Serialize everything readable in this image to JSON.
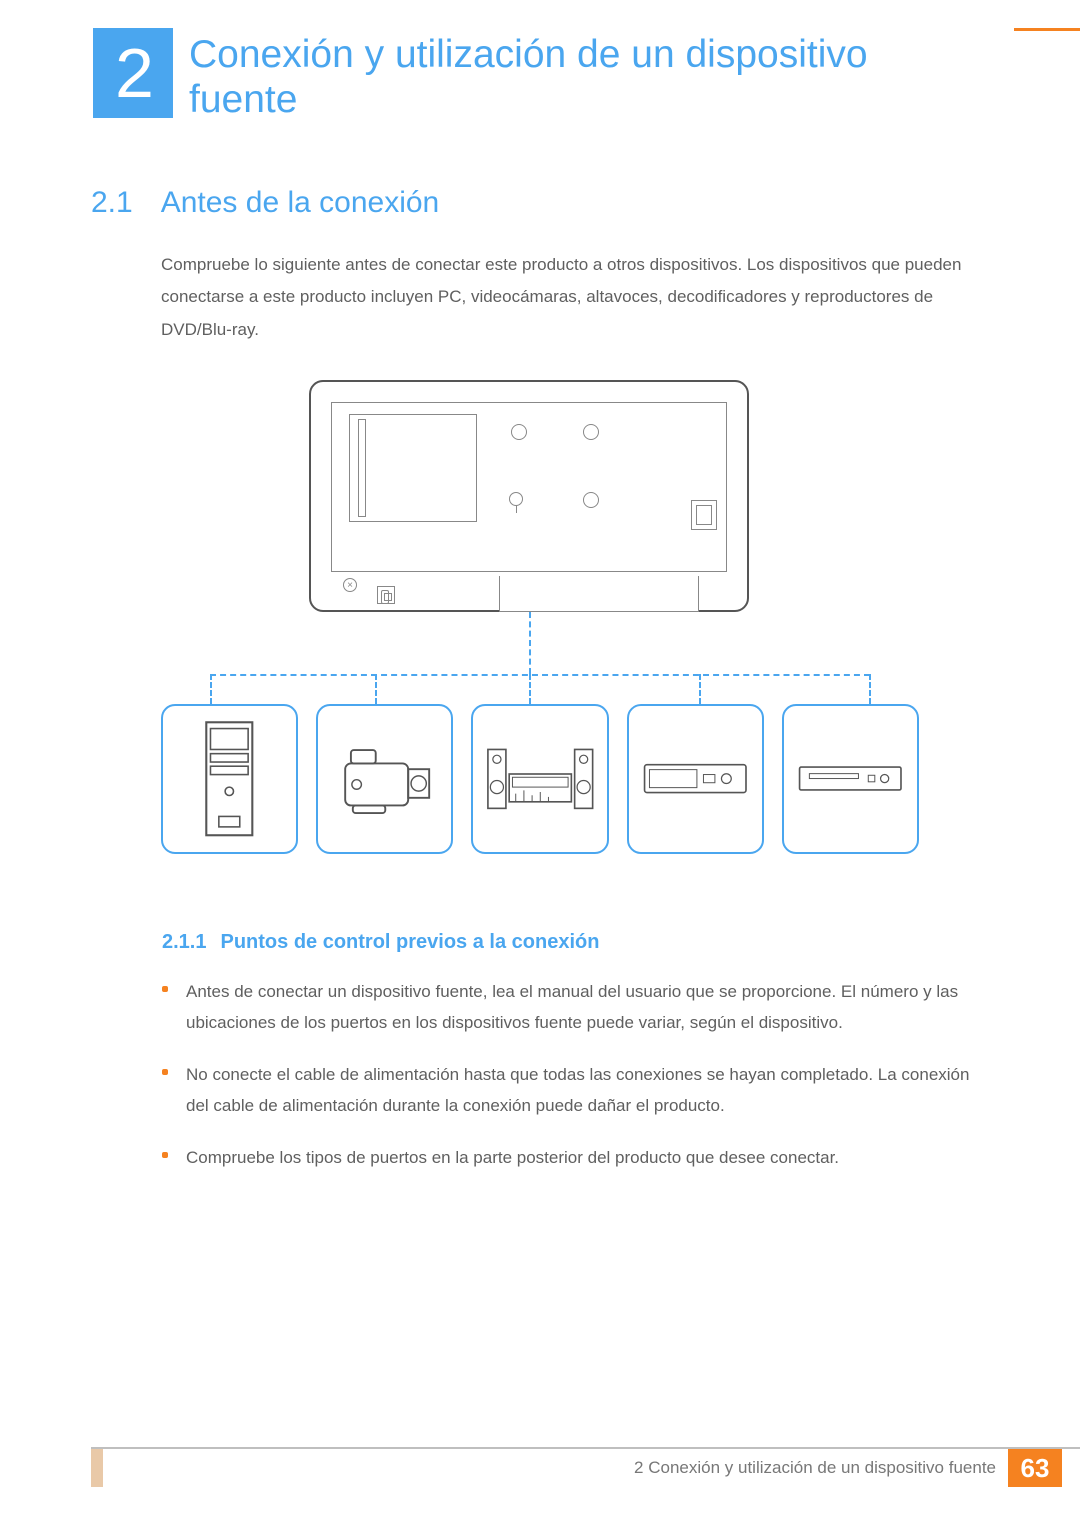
{
  "chapter": {
    "number": "2",
    "title": "Conexión y utilización de un dispositivo fuente"
  },
  "section": {
    "number": "2.1",
    "title": "Antes de la conexión",
    "paragraph": "Compruebe lo siguiente antes de conectar este producto a otros dispositivos. Los dispositivos que pueden conectarse a este producto incluyen PC, videocámaras, altavoces, decodificadores y reproductores de DVD/Blu-ray."
  },
  "subsection": {
    "number": "2.1.1",
    "title": "Puntos de control previos a la conexión",
    "bullets": [
      "Antes de conectar un dispositivo fuente, lea el manual del usuario que se proporcione. El número y las ubicaciones de los puertos en los dispositivos fuente puede variar, según el dispositivo.",
      "No conecte el cable de alimentación hasta que todas las conexiones se hayan completado. La conexión del cable de alimentación durante la conexión puede dañar el producto.",
      "Compruebe los tipos de puertos en la parte posterior del producto que desee conectar."
    ]
  },
  "diagram": {
    "devices": [
      "pc-tower",
      "camcorder",
      "speakers-receiver",
      "set-top-box",
      "dvd-player"
    ]
  },
  "footer": {
    "text": "2 Conexión y utilización de un dispositivo fuente",
    "page": "63"
  }
}
